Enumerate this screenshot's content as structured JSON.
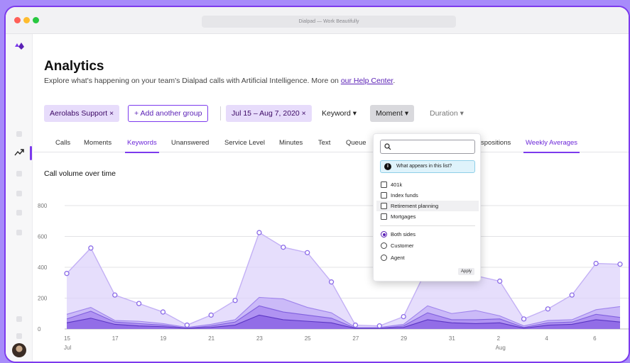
{
  "window": {
    "title": "Dialpad — Work Beautifully"
  },
  "colors": {
    "accent": "#7c3aed",
    "chip_bg": "#e7dcfb",
    "dropdown_info_bg": "#dff3fb"
  },
  "sidebar": {
    "icons": [
      "dialpad-logo-icon",
      "trend-icon",
      "avatar"
    ]
  },
  "header": {
    "title": "Analytics",
    "subtitle": "Explore what's happening on your team's Dialpad calls with Artificial Intelligence. More on ",
    "help_link": "our Help Center",
    "subtitle_end": "."
  },
  "filters": {
    "group_chip": "Aerolabs Support ×",
    "add_group": "+ Add another group",
    "date_chip": "Jul 15 – Aug 7, 2020 ×",
    "keyword": "Keyword ▾",
    "moment": "Moment ▾",
    "duration": "Duration ▾"
  },
  "tabs": [
    "Calls",
    "Moments",
    "Keywords",
    "Unanswered",
    "Service Level",
    "Minutes",
    "Text",
    "Queue",
    "spositions",
    "Weekly Averages"
  ],
  "active_tabs": [
    "Keywords",
    "Weekly Averages"
  ],
  "card": {
    "title": "Call volume over time"
  },
  "dropdown": {
    "search_placeholder": "",
    "info_text": "What appears in this list?",
    "checkboxes": [
      "401k",
      "Index funds",
      "Retirement planning",
      "Mortgages"
    ],
    "highlighted": "Retirement planning",
    "radios": [
      "Both sides",
      "Customer",
      "Agent"
    ],
    "selected_radio": "Both sides",
    "apply": "Apply"
  },
  "chart_data": {
    "type": "area",
    "x": [
      15,
      16,
      17,
      18,
      19,
      20,
      21,
      22,
      23,
      24,
      25,
      26,
      27,
      28,
      29,
      30,
      31,
      1,
      2,
      3,
      4,
      5,
      6,
      7
    ],
    "tick_labels": [
      "15",
      "17",
      "19",
      "21",
      "23",
      "25",
      "27",
      "29",
      "31",
      "2",
      "4",
      "6"
    ],
    "month_labels": [
      "Jul",
      "Aug"
    ],
    "ylim": [
      0,
      800
    ],
    "yticks": [
      0,
      200,
      400,
      600,
      800
    ],
    "series": [
      {
        "values": [
          360,
          525,
          220,
          165,
          110,
          25,
          90,
          185,
          625,
          530,
          495,
          305,
          25,
          20,
          80,
          400,
          390,
          345,
          310,
          65,
          130,
          220,
          425,
          420
        ]
      },
      {
        "values": [
          95,
          140,
          55,
          50,
          35,
          10,
          30,
          60,
          205,
          195,
          140,
          105,
          10,
          10,
          30,
          150,
          100,
          120,
          85,
          20,
          55,
          60,
          125,
          145
        ]
      },
      {
        "values": [
          65,
          115,
          45,
          35,
          25,
          5,
          20,
          45,
          150,
          110,
          90,
          70,
          5,
          5,
          20,
          105,
          60,
          60,
          65,
          10,
          40,
          45,
          95,
          75
        ]
      },
      {
        "values": [
          40,
          70,
          30,
          20,
          15,
          3,
          10,
          25,
          90,
          60,
          50,
          40,
          3,
          3,
          10,
          60,
          40,
          35,
          40,
          5,
          25,
          30,
          60,
          45
        ]
      }
    ]
  }
}
